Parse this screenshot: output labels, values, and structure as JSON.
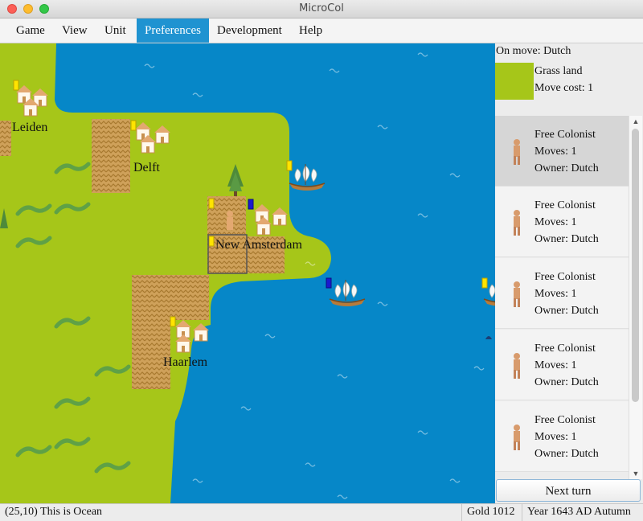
{
  "window": {
    "title": "MicroCol"
  },
  "menu": [
    {
      "label": "Game",
      "active": false
    },
    {
      "label": "View",
      "active": false
    },
    {
      "label": "Unit",
      "active": false
    },
    {
      "label": "Preferences",
      "active": true
    },
    {
      "label": "Development",
      "active": false
    },
    {
      "label": "Help",
      "active": false
    }
  ],
  "map": {
    "cities": [
      {
        "name": "Leiden"
      },
      {
        "name": "Delft"
      },
      {
        "name": "New Amsterdam"
      },
      {
        "name": "Haarlem"
      }
    ],
    "colors": {
      "ocean": "#0687c8",
      "land": "#a6c619",
      "flag_dutch": "#ffe400",
      "flag_blue": "#1a1ad0"
    }
  },
  "sidebar": {
    "on_move": "On move: Dutch",
    "tile": {
      "name": "Grass land",
      "move_cost": "Move cost: 1",
      "color": "#a6c619"
    },
    "units": [
      {
        "name": "Free Colonist",
        "moves": "Moves: 1",
        "owner": "Owner: Dutch",
        "selected": true
      },
      {
        "name": "Free Colonist",
        "moves": "Moves: 1",
        "owner": "Owner: Dutch",
        "selected": false
      },
      {
        "name": "Free Colonist",
        "moves": "Moves: 1",
        "owner": "Owner: Dutch",
        "selected": false
      },
      {
        "name": "Free Colonist",
        "moves": "Moves: 1",
        "owner": "Owner: Dutch",
        "selected": false
      },
      {
        "name": "Free Colonist",
        "moves": "Moves: 1",
        "owner": "Owner: Dutch",
        "selected": false
      }
    ],
    "next_turn": "Next turn"
  },
  "status": {
    "message": "(25,10) This is Ocean",
    "gold": "Gold 1012",
    "year": "Year 1643 AD Autumn"
  }
}
